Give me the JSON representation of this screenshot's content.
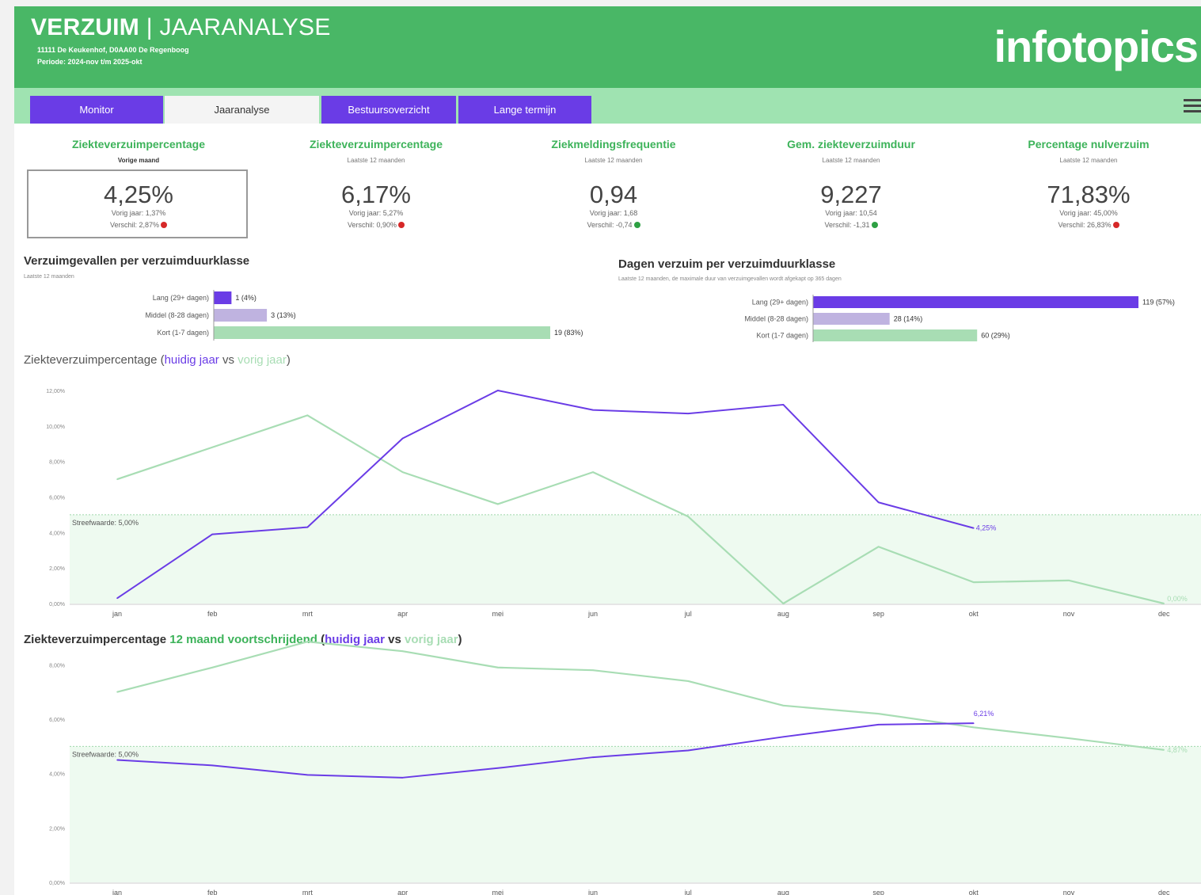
{
  "header": {
    "title_bold": "VERZUIM",
    "title_sep": " | ",
    "title_light": "JAARANALYSE",
    "line1": "11111 De Keukenhof, D0AA00 De Regenboog",
    "line2": "Periode: 2024-nov t/m 2025-okt",
    "logo": "infotopics"
  },
  "tabs": [
    {
      "label": "Monitor",
      "active": false
    },
    {
      "label": "Jaaranalyse",
      "active": true
    },
    {
      "label": "Bestuursoverzicht",
      "active": false
    },
    {
      "label": "Lange termijn",
      "active": false
    }
  ],
  "menu_icon": "hamburger-icon",
  "colors": {
    "header_green": "#49b766",
    "nav_green": "#9fe3b1",
    "purple": "#6a3ce6",
    "lavender": "#bfb3e0",
    "light_green": "#a8ddb4",
    "red": "#d62828",
    "status_green": "#2ea043"
  },
  "kpis": [
    {
      "title": "Ziekteverzuimpercentage",
      "subtitle": "Vorige maand",
      "value": "4,25%",
      "prev": "Vorig jaar: 1,37%",
      "diff": "Verschil: 2,87%",
      "status": "red"
    },
    {
      "title": "Ziekteverzuimpercentage",
      "subtitle": "Laatste 12 maanden",
      "value": "6,17%",
      "prev": "Vorig jaar: 5,27%",
      "diff": "Verschil: 0,90%",
      "status": "red"
    },
    {
      "title": "Ziekmeldingsfrequentie",
      "subtitle": "Laatste 12 maanden",
      "value": "0,94",
      "prev": "Vorig jaar: 1,68",
      "diff": "Verschil: -0,74",
      "status": "green"
    },
    {
      "title": "Gem. ziekteverzuimduur",
      "subtitle": "Laatste 12 maanden",
      "value": "9,227",
      "prev": "Vorig jaar: 10,54",
      "diff": "Verschil: -1,31",
      "status": "green"
    },
    {
      "title": "Percentage nulverzuim",
      "subtitle": "Laatste 12 maanden",
      "value": "71,83%",
      "prev": "Vorig jaar: 45,00%",
      "diff": "Verschil: 26,83%",
      "status": "red"
    }
  ],
  "cases_panel": {
    "title": "Verzuimgevallen per verzuimduurklasse",
    "subtitle": "Laatste 12 maanden"
  },
  "days_panel": {
    "title": "Dagen verzuim per verzuimduurklasse",
    "subtitle": "Laatste 12 maanden, de maximale duur van verzuimgevallen wordt afgekapt op 365 dagen"
  },
  "chart1_title": {
    "p1": "Ziekteverzuimpercentage (",
    "cur": "huidig jaar",
    "vs": " vs ",
    "prev": "vorig jaar",
    "p2": ")"
  },
  "chart2_title": {
    "p1": "Ziekteverzuimpercentage ",
    "rolling": "12 maand voortschrijdend",
    "p2": " (",
    "cur": "huidig jaar",
    "vs": " vs ",
    "prev": "vorig jaar",
    "p3": ")"
  },
  "chart_data": [
    {
      "type": "bar",
      "title": "Verzuimgevallen per verzuimduurklasse",
      "categories": [
        "Lang (29+ dagen)",
        "Middel (8-28 dagen)",
        "Kort (1-7 dagen)"
      ],
      "values": [
        1,
        3,
        19
      ],
      "data_labels": [
        "1 (4%)",
        "3 (13%)",
        "19 (83%)"
      ],
      "colors": [
        "#6a3ce6",
        "#bfb3e0",
        "#a8ddb4"
      ],
      "orientation": "horizontal"
    },
    {
      "type": "bar",
      "title": "Dagen verzuim per verzuimduurklasse",
      "categories": [
        "Lang (29+ dagen)",
        "Middel (8-28 dagen)",
        "Kort (1-7 dagen)"
      ],
      "values": [
        119,
        28,
        60
      ],
      "data_labels": [
        "119 (57%)",
        "28 (14%)",
        "60 (29%)"
      ],
      "colors": [
        "#6a3ce6",
        "#bfb3e0",
        "#a8ddb4"
      ],
      "orientation": "horizontal"
    },
    {
      "type": "line",
      "categories": [
        "jan",
        "feb",
        "mrt",
        "apr",
        "mei",
        "jun",
        "jul",
        "aug",
        "sep",
        "okt",
        "nov",
        "dec"
      ],
      "ylim": [
        0,
        12
      ],
      "yticks": [
        "0,00%",
        "2,00%",
        "4,00%",
        "6,00%",
        "8,00%",
        "10,00%",
        "12,00%"
      ],
      "target": 5.0,
      "target_label": "Streefwaarde: 5,00%",
      "series": [
        {
          "role": "huidig jaar",
          "color": "#6a3ce6",
          "values": [
            0.3,
            3.9,
            4.3,
            9.3,
            12.0,
            10.9,
            10.7,
            11.2,
            5.7,
            4.25,
            null,
            null
          ],
          "end_label": "4,25%"
        },
        {
          "role": "vorig jaar",
          "color": "#a8ddb4",
          "values": [
            7.0,
            8.8,
            10.6,
            7.4,
            5.6,
            7.4,
            4.9,
            0.0,
            3.2,
            1.2,
            1.3,
            0.0
          ],
          "end_label": "0,00%"
        }
      ]
    },
    {
      "type": "line",
      "categories": [
        "jan",
        "feb",
        "mrt",
        "apr",
        "mei",
        "jun",
        "jul",
        "aug",
        "sep",
        "okt",
        "nov",
        "dec"
      ],
      "ylim": [
        0,
        9
      ],
      "yticks": [
        "0,00%",
        "2,00%",
        "4,00%",
        "6,00%",
        "8,00%"
      ],
      "target": 5.0,
      "target_label": "Streefwaarde: 5,00%",
      "series": [
        {
          "role": "huidig jaar",
          "color": "#6a3ce6",
          "values": [
            4.5,
            4.3,
            3.95,
            3.85,
            4.2,
            4.6,
            4.85,
            5.35,
            5.8,
            5.85,
            null,
            null
          ],
          "end_label": "6,21%"
        },
        {
          "role": "vorig jaar",
          "color": "#a8ddb4",
          "values": [
            7.0,
            7.9,
            8.85,
            8.5,
            7.9,
            7.8,
            7.4,
            6.5,
            6.2,
            5.7,
            5.3,
            4.87
          ],
          "end_label": "4,87%"
        }
      ]
    }
  ]
}
